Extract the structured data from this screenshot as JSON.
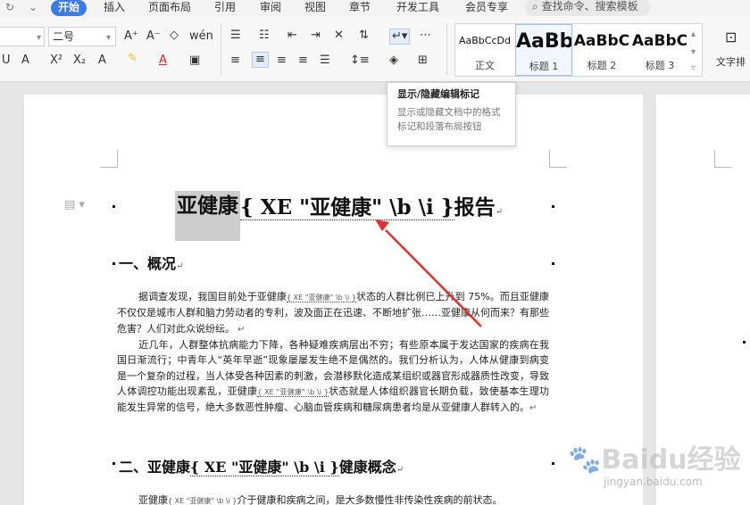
{
  "menu": {
    "items": [
      "开始",
      "插入",
      "页面布局",
      "引用",
      "审阅",
      "视图",
      "章节",
      "开发工具",
      "会员专享"
    ],
    "active": "开始",
    "search_placeholder": "查找命令、搜索模板"
  },
  "ribbon": {
    "font_size": "二号",
    "styles": [
      {
        "preview": "AaBbCcDd",
        "name": "正文"
      },
      {
        "preview": "AaBb",
        "name": "标题 1"
      },
      {
        "preview": "AaBbC",
        "name": "标题 2"
      },
      {
        "preview": "AaBbC",
        "name": "标题 3"
      }
    ],
    "text_layout_label": "文字排"
  },
  "tooltip": {
    "title": "显示/隐藏编辑标记",
    "description": "显示或隐藏文档中的格式标记和段落布局按钮"
  },
  "document": {
    "title_part1": "亚健康",
    "title_field": "{ XE \"亚健康\" \\b \\i }",
    "title_part2": "报告",
    "h1": "一、概况",
    "p1_a": "据调查发现，我国目前处于亚健康",
    "p1_code": "{ XE \"亚健康\" \\b \\i }",
    "p1_b": "状态的人群比例已上升到 75%。而且亚健康不仅仅是城市人群和脑力劳动者的专利，波及面正在迅速、不断地扩张……亚健康从何而来？有那些危害？人们对此众说纷纭。",
    "p2_a": "近几年，人群整体抗病能力下降，各种疑难疾病层出不穷；有些原本属于发达国家的疾病在我国日渐流行；中青年人“英年早逝”现象屡屡发生绝不是偶然的。我们分析认为，人体从健康到病变是一个复杂的过程，当人体受各种因素的刺激，会潜移默化造成某组织或器官形成器质性改变，导致人体调控功能出现紊乱，亚健康",
    "p2_code": "{ XE \"亚健康\" \\b \\i }",
    "p2_b": "状态就是人体组织器官长期负载，致使基本生理功能发生异常的信号，绝大多数恶性肿瘤、心脑血管疾病和糖尿病患者均是从亚健康人群转入的。",
    "h2_a": "二、亚健康",
    "h2_field": "{ XE \"亚健康\" \\b \\i }",
    "h2_b": "健康概念",
    "p3_a": "亚健康",
    "p3_code": "{ XE \"亚健康\" \\b \\i }",
    "p3_b": "介于健康和疾病之间，是大多数慢性非传染性疾病的前状态。"
  },
  "watermark": {
    "main": "Baidu经验",
    "sub": "jingyan.baidu.com"
  },
  "colors": {
    "accent": "#3c7be4",
    "arrow": "#e0312f"
  }
}
